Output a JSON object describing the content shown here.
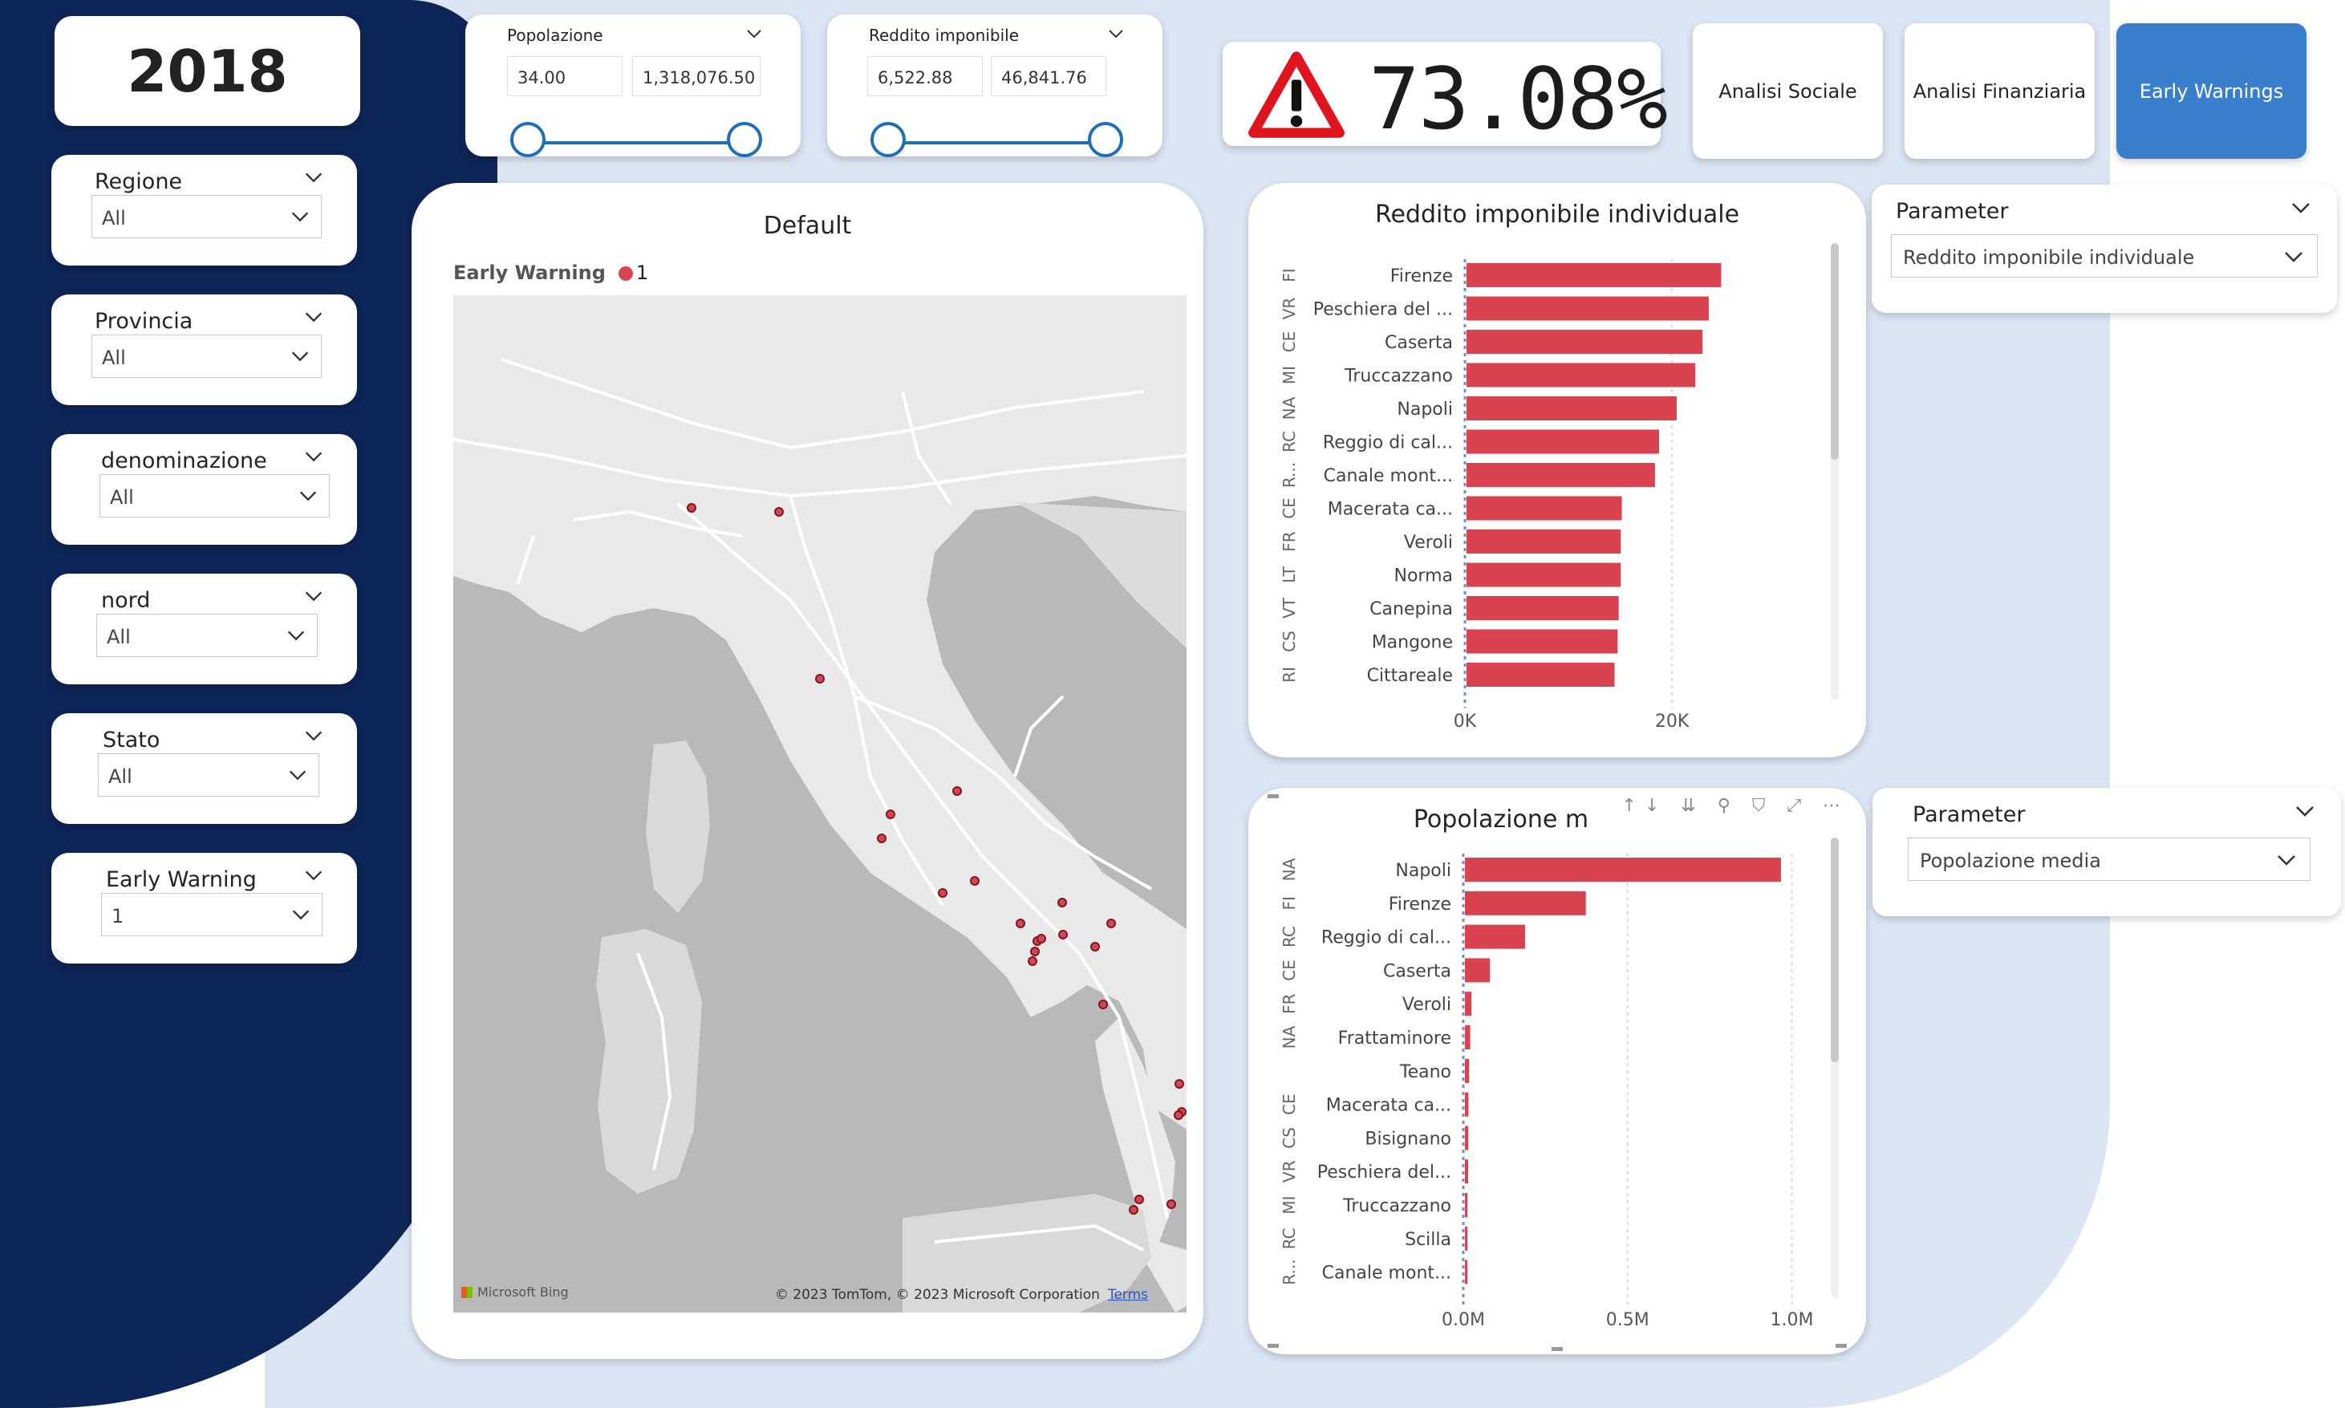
{
  "year": "2018",
  "slicers": [
    {
      "title": "Regione",
      "value": "All"
    },
    {
      "title": "Provincia",
      "value": "All"
    },
    {
      "title": "denominazione",
      "value": "All"
    },
    {
      "title": "nord",
      "value": "All"
    },
    {
      "title": "Stato",
      "value": "All"
    },
    {
      "title": "Early Warning",
      "value": "1"
    }
  ],
  "range_popolazione": {
    "title": "Popolazione",
    "min": "34.00",
    "max": "1,318,076.50"
  },
  "range_reddito": {
    "title": "Reddito imponibile",
    "min": "6,522.88",
    "max": "46,841.76"
  },
  "kpi": {
    "value": "73.08%",
    "icon": "warning-triangle-icon",
    "icon_color": "#e0141e"
  },
  "nav": {
    "social": "Analisi Sociale",
    "financial": "Analisi Finanziaria",
    "early": "Early Warnings"
  },
  "map": {
    "title": "Default",
    "legend_title": "Early Warning",
    "legend_value": "1",
    "marker_color": "#d64550",
    "logo": "Microsoft Bing",
    "attribution": "© 2023 TomTom, © 2023 Microsoft Corporation",
    "terms": "Terms"
  },
  "param1": {
    "title": "Parameter",
    "value": "Reddito imponibile individuale"
  },
  "param2": {
    "title": "Parameter",
    "value": "Popolazione media"
  },
  "colors": {
    "navy": "#0e2557",
    "light_bg": "#dce5f3",
    "accent_blue": "#3a7fcc",
    "bar": "#d9434f"
  },
  "chart_data": [
    {
      "type": "bar",
      "orientation": "horizontal",
      "title": "Reddito imponibile individuale",
      "groups": [
        "FI",
        "VR",
        "CE",
        "MI",
        "NA",
        "RC",
        "R...",
        "CE",
        "FR",
        "LT",
        "VT",
        "CS",
        "RI"
      ],
      "categories": [
        "Firenze",
        "Peschiera del ...",
        "Caserta",
        "Truccazzano",
        "Napoli",
        "Reggio di cal...",
        "Canale mont...",
        "Macerata ca...",
        "Veroli",
        "Norma",
        "Canepina",
        "Mangone",
        "Cittareale"
      ],
      "values": [
        24600,
        23400,
        22800,
        22100,
        20300,
        18600,
        18200,
        15000,
        14900,
        14900,
        14700,
        14600,
        14300
      ],
      "xticks": [
        "0K",
        "20K"
      ],
      "xlim": [
        0,
        31000
      ]
    },
    {
      "type": "bar",
      "orientation": "horizontal",
      "title": "Popolazione media",
      "title_visible": "Popolazione m",
      "groups": [
        "NA",
        "FI",
        "RC",
        "CE",
        "FR",
        "NA",
        "",
        "CE",
        "CS",
        "VR",
        "MI",
        "RC",
        "R..."
      ],
      "categories": [
        "Napoli",
        "Firenze",
        "Reggio di cal...",
        "Caserta",
        "Veroli",
        "Frattaminore",
        "Teano",
        "Macerata ca...",
        "Bisignano",
        "Peschiera del...",
        "Truccazzano",
        "Scilla",
        "Canale mont..."
      ],
      "values": [
        962000,
        368000,
        183000,
        76000,
        20000,
        16000,
        12500,
        10700,
        10300,
        9800,
        6000,
        4900,
        4200
      ],
      "xticks": [
        "0.0M",
        "0.5M",
        "1.0M"
      ],
      "xlim": [
        0,
        1050000
      ]
    }
  ]
}
